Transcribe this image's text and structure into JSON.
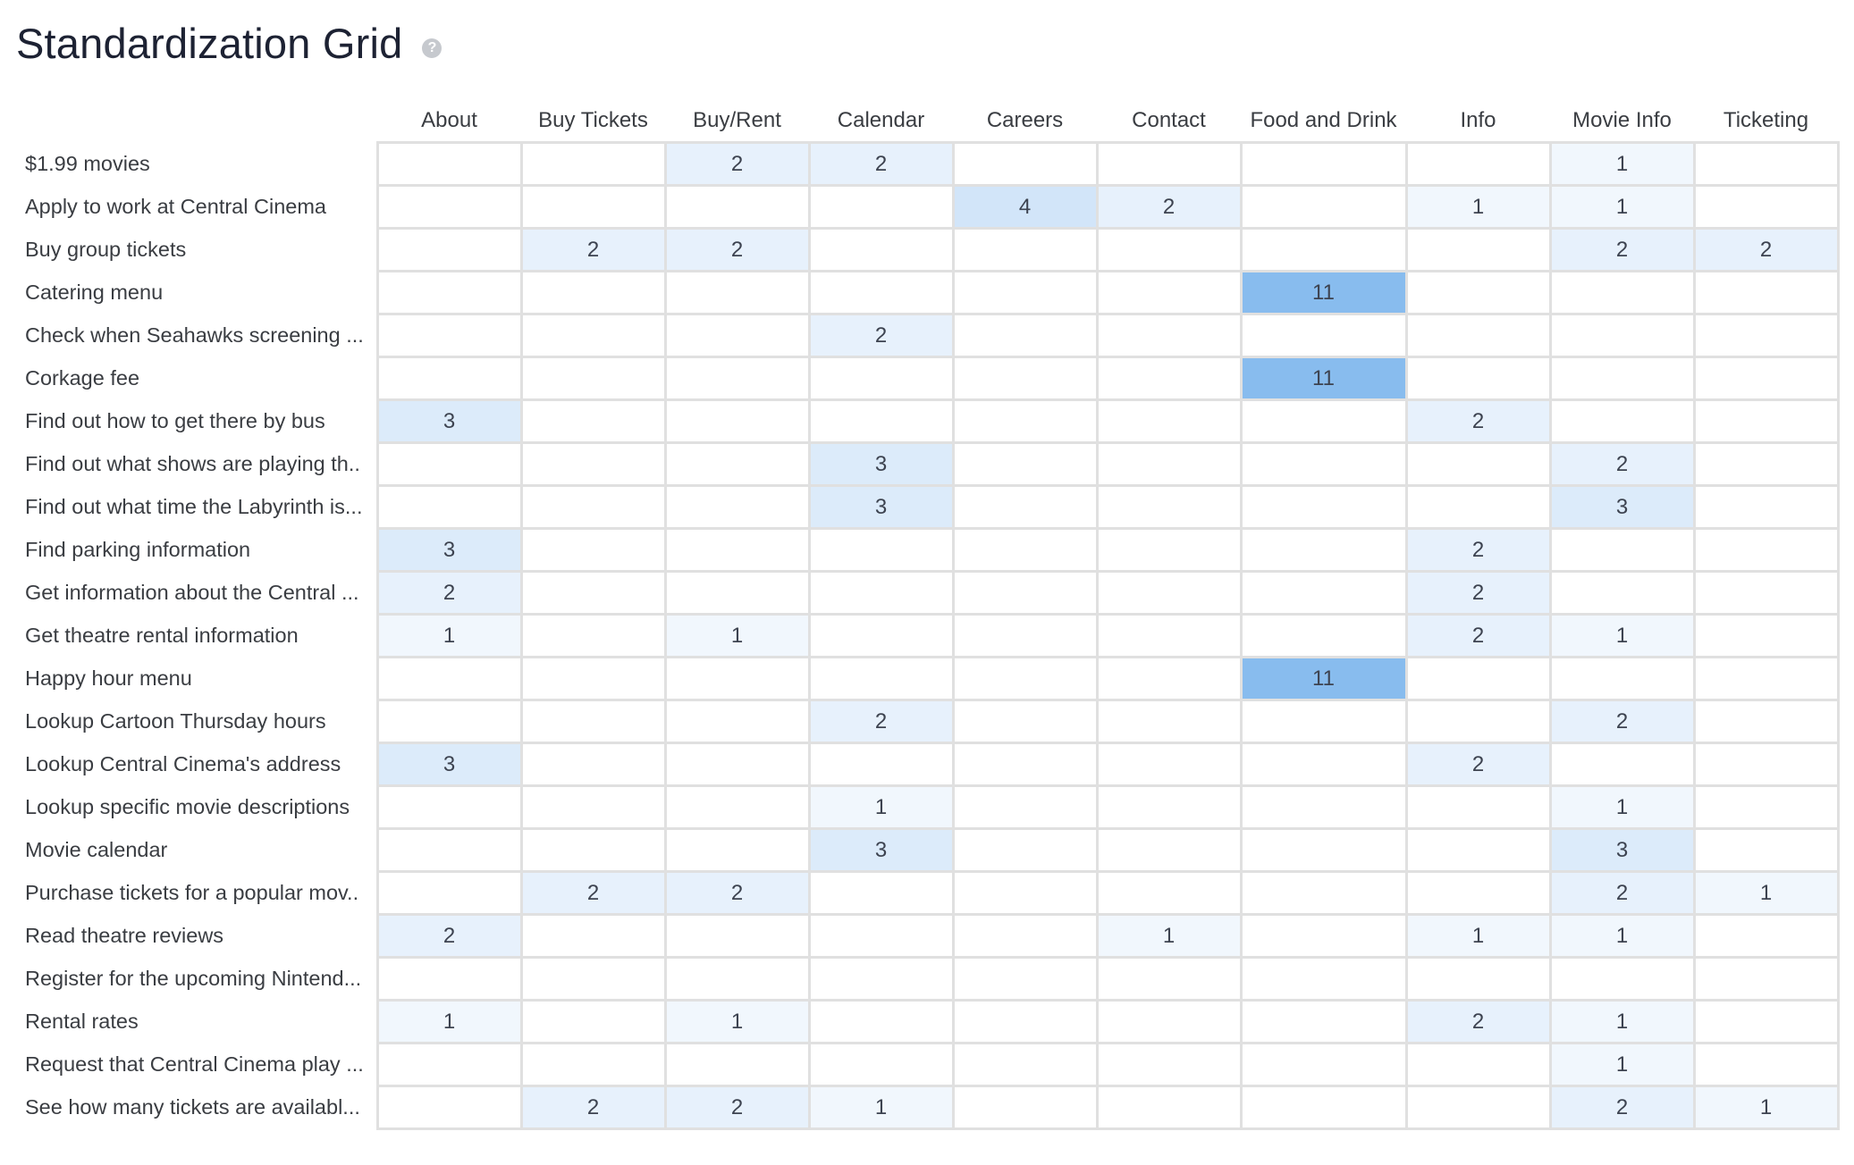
{
  "title": "Standardization Grid",
  "help_icon": "help-circle-icon",
  "columns": [
    "About",
    "Buy Tickets",
    "Buy/Rent",
    "Calendar",
    "Careers",
    "Contact",
    "Food and Drink",
    "Info",
    "Movie Info",
    "Ticketing"
  ],
  "column_widths": [
    161,
    161,
    161,
    161,
    161,
    161,
    185,
    161,
    161,
    161
  ],
  "max_value": 11,
  "colors": {
    "low": "#f1f7fd",
    "high": "#88bcee",
    "border": "#e0e0e0",
    "text": "#3a3d42"
  },
  "rows": [
    {
      "label": "$1.99 movies",
      "values": [
        null,
        null,
        2,
        2,
        null,
        null,
        null,
        null,
        1,
        null
      ]
    },
    {
      "label": "Apply to work at Central Cinema",
      "values": [
        null,
        null,
        null,
        null,
        4,
        2,
        null,
        1,
        1,
        null
      ]
    },
    {
      "label": "Buy group tickets",
      "values": [
        null,
        2,
        2,
        null,
        null,
        null,
        null,
        null,
        2,
        2
      ]
    },
    {
      "label": "Catering menu",
      "values": [
        null,
        null,
        null,
        null,
        null,
        null,
        11,
        null,
        null,
        null
      ]
    },
    {
      "label": "Check when Seahawks screening ...",
      "values": [
        null,
        null,
        null,
        2,
        null,
        null,
        null,
        null,
        null,
        null
      ]
    },
    {
      "label": "Corkage fee",
      "values": [
        null,
        null,
        null,
        null,
        null,
        null,
        11,
        null,
        null,
        null
      ]
    },
    {
      "label": "Find out how to get there by bus",
      "values": [
        3,
        null,
        null,
        null,
        null,
        null,
        null,
        2,
        null,
        null
      ]
    },
    {
      "label": "Find out what shows are playing th..",
      "values": [
        null,
        null,
        null,
        3,
        null,
        null,
        null,
        null,
        2,
        null
      ]
    },
    {
      "label": "Find out what time the Labyrinth is...",
      "values": [
        null,
        null,
        null,
        3,
        null,
        null,
        null,
        null,
        3,
        null
      ]
    },
    {
      "label": "Find parking information",
      "values": [
        3,
        null,
        null,
        null,
        null,
        null,
        null,
        2,
        null,
        null
      ]
    },
    {
      "label": "Get information about the Central ...",
      "values": [
        2,
        null,
        null,
        null,
        null,
        null,
        null,
        2,
        null,
        null
      ]
    },
    {
      "label": "Get theatre rental information",
      "values": [
        1,
        null,
        1,
        null,
        null,
        null,
        null,
        2,
        1,
        null
      ]
    },
    {
      "label": "Happy hour menu",
      "values": [
        null,
        null,
        null,
        null,
        null,
        null,
        11,
        null,
        null,
        null
      ]
    },
    {
      "label": "Lookup Cartoon Thursday hours",
      "values": [
        null,
        null,
        null,
        2,
        null,
        null,
        null,
        null,
        2,
        null
      ]
    },
    {
      "label": "Lookup Central Cinema's address",
      "values": [
        3,
        null,
        null,
        null,
        null,
        null,
        null,
        2,
        null,
        null
      ]
    },
    {
      "label": "Lookup specific movie descriptions",
      "values": [
        null,
        null,
        null,
        1,
        null,
        null,
        null,
        null,
        1,
        null
      ]
    },
    {
      "label": "Movie calendar",
      "values": [
        null,
        null,
        null,
        3,
        null,
        null,
        null,
        null,
        3,
        null
      ]
    },
    {
      "label": "Purchase tickets for a popular mov..",
      "values": [
        null,
        2,
        2,
        null,
        null,
        null,
        null,
        null,
        2,
        1
      ]
    },
    {
      "label": "Read theatre reviews",
      "values": [
        2,
        null,
        null,
        null,
        null,
        1,
        null,
        1,
        1,
        null
      ]
    },
    {
      "label": "Register for the upcoming Nintend...",
      "values": [
        null,
        null,
        null,
        null,
        null,
        null,
        null,
        null,
        null,
        null
      ]
    },
    {
      "label": "Rental rates",
      "values": [
        1,
        null,
        1,
        null,
        null,
        null,
        null,
        2,
        1,
        null
      ]
    },
    {
      "label": "Request that Central Cinema play ...",
      "values": [
        null,
        null,
        null,
        null,
        null,
        null,
        null,
        null,
        1,
        null
      ]
    },
    {
      "label": "See how many tickets are availabl...",
      "values": [
        null,
        2,
        2,
        1,
        null,
        null,
        null,
        null,
        2,
        1
      ]
    }
  ]
}
